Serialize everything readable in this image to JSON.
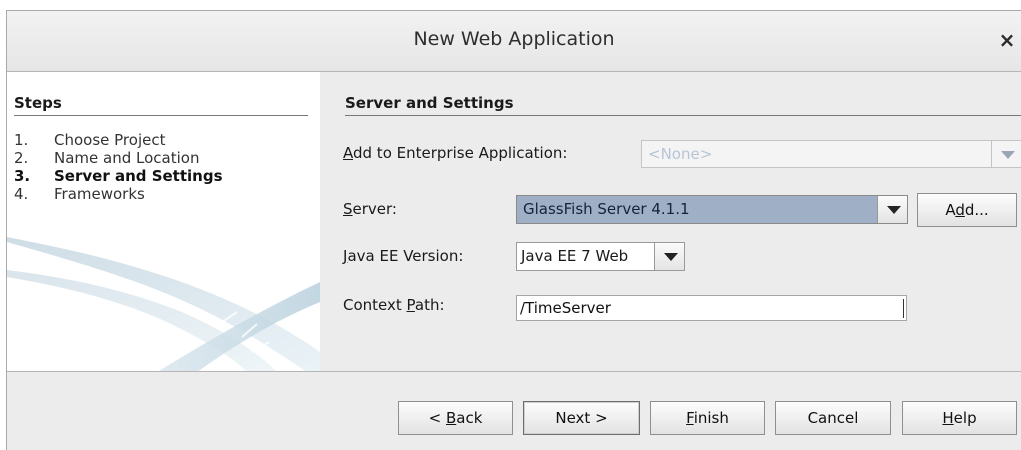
{
  "dialog": {
    "title": "New Web Application",
    "close_glyph": "×"
  },
  "steps": {
    "heading": "Steps",
    "items": [
      {
        "num": "1.",
        "label": "Choose Project"
      },
      {
        "num": "2.",
        "label": "Name and Location"
      },
      {
        "num": "3.",
        "label": "Server and Settings"
      },
      {
        "num": "4.",
        "label": "Frameworks"
      }
    ],
    "active_index": 2
  },
  "panel": {
    "heading": "Server and Settings",
    "enterprise": {
      "label_mnemonic": "A",
      "label_rest": "dd to Enterprise Application:",
      "value": "<None>",
      "enabled": false
    },
    "server": {
      "label_mnemonic": "S",
      "label_rest": "erver:",
      "value": "GlassFish Server 4.1.1",
      "add_pre": "A",
      "add_mnemonic": "d",
      "add_post": "d..."
    },
    "javaee": {
      "label_mnemonic": "J",
      "label_rest": "ava EE Version:",
      "value": "Java EE 7 Web"
    },
    "context": {
      "label_pre": "Context ",
      "label_mnemonic": "P",
      "label_rest": "ath:",
      "value": "/TimeServer"
    }
  },
  "footer": {
    "back_pre": "< ",
    "back_mnemonic": "B",
    "back_rest": "ack",
    "next": "Next >",
    "finish_mnemonic": "F",
    "finish_rest": "inish",
    "cancel": "Cancel",
    "help_mnemonic": "H",
    "help_rest": "elp"
  },
  "colors": {
    "selection": "#9fb0c6",
    "dialog_bg": "#ececec",
    "disabled_text": "#b7c4d6"
  }
}
